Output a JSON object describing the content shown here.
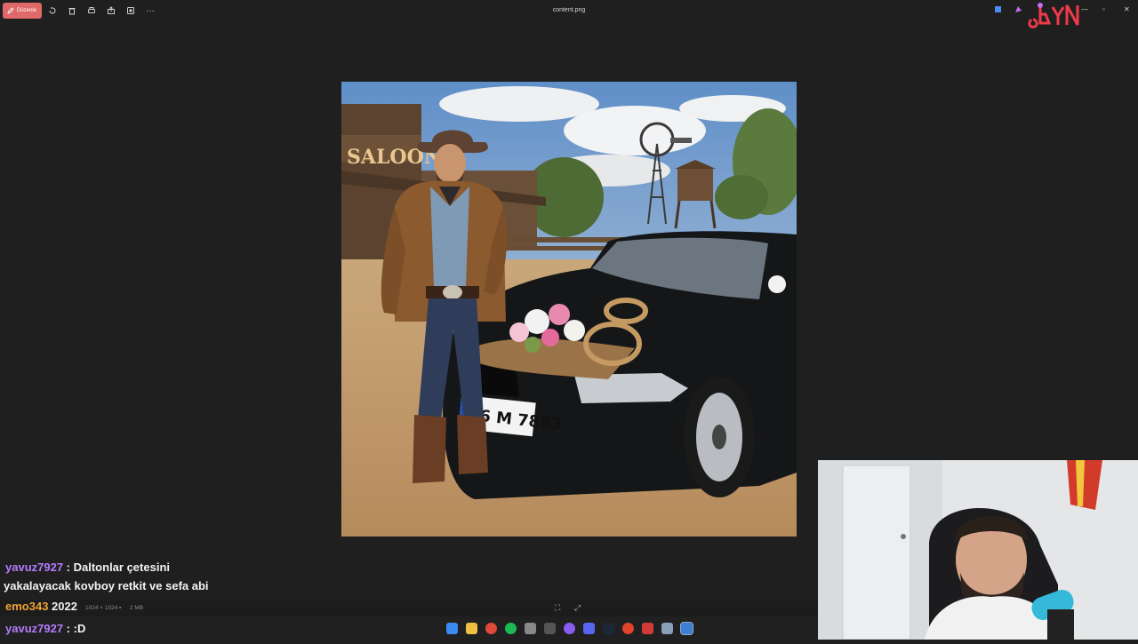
{
  "toolbar": {
    "edit_label": "Düzenle",
    "edit_icon": "pencil-icon",
    "tools": [
      "rotate-icon",
      "trash-icon",
      "print-icon",
      "share-icon",
      "fit-icon",
      "more-icon"
    ],
    "more_label": "···"
  },
  "window": {
    "filename": "content.png",
    "minimize": "—",
    "maximize": "▫",
    "close": "✕"
  },
  "chat": [
    {
      "user": "yavuz7927",
      "separator": " : ",
      "message": "Daltonlar çetesini",
      "continuation": "yakalayacak kovboy retkit ve sefa abi"
    },
    {
      "user": "emo343",
      "separator": " ",
      "message": "2022"
    },
    {
      "user": "yavuz7927",
      "separator": " : ",
      "message": ":D"
    }
  ],
  "status": {
    "dimensions": "1024 × 1024",
    "size": "2 MB"
  },
  "photo": {
    "sign_text": "SALOON",
    "plate_text": "06 M 7883"
  },
  "colors": {
    "accent": "#e06868",
    "chat_user_purple": "#b47cff",
    "chat_user_orange": "#f0a238",
    "background": "#1f1f1f"
  }
}
